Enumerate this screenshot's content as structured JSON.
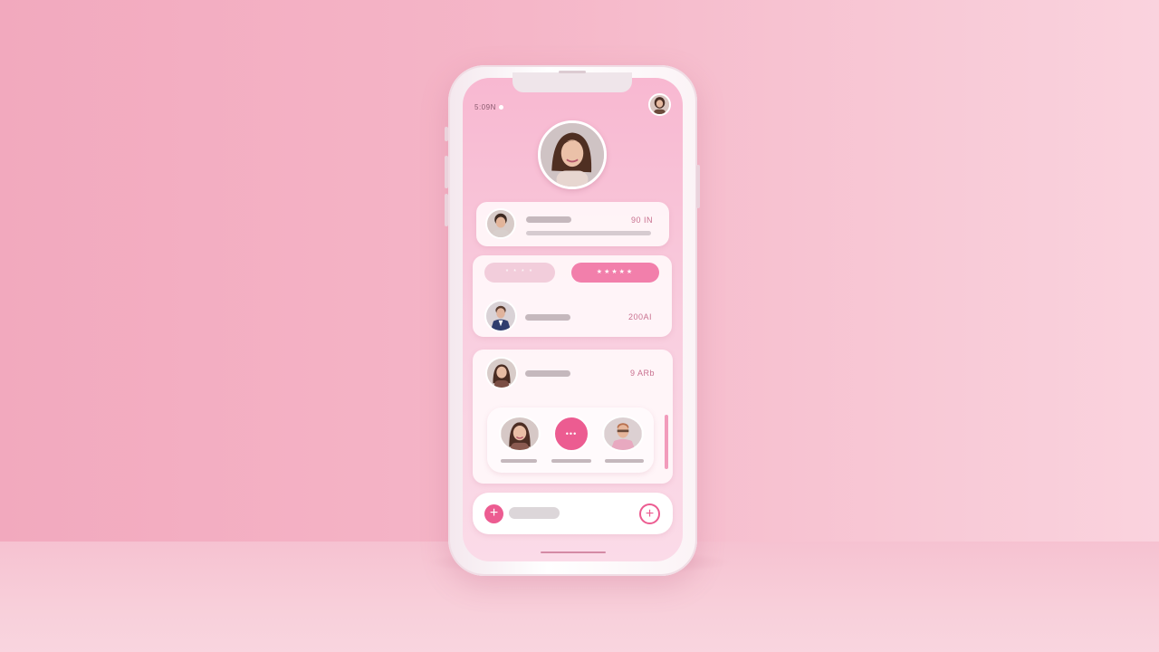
{
  "status_bar": {
    "time": "5:09N"
  },
  "top_right_avatar": {
    "icon": "avatar-icon"
  },
  "profile": {
    "avatar_icon": "avatar-icon"
  },
  "card1": {
    "value": "90 IN"
  },
  "card2": {
    "pill_left": "* * * *",
    "pill_right": "★★★★★",
    "value": "200AI"
  },
  "card3": {
    "value": "9 ARb",
    "contacts_more_label": "•••"
  },
  "bottom_bar": {
    "add_left_icon": "plus-icon",
    "add_right_icon": "plus-circle-icon"
  },
  "colors": {
    "accent": "#ec5c91",
    "background": "#f5b6c8",
    "card": "#fff7fa"
  }
}
